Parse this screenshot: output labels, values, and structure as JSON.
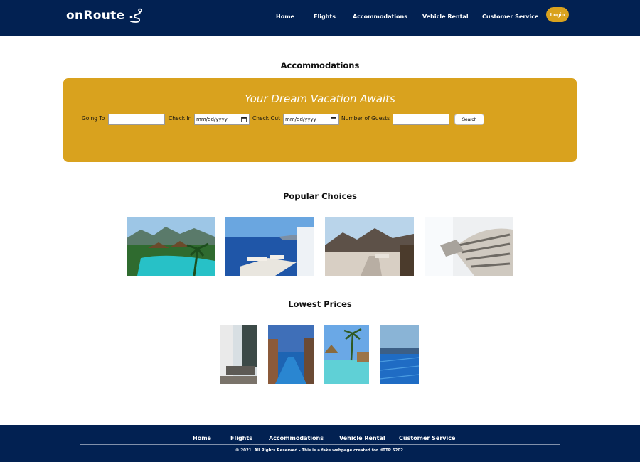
{
  "header": {
    "brand": "onRoute",
    "nav": [
      "Home",
      "Flights",
      "Accommodations",
      "Vehicle Rental",
      "Customer Service"
    ],
    "login_label": "Login"
  },
  "main": {
    "page_title": "Accommodations",
    "search": {
      "heading": "Your Dream Vacation Awaits",
      "going_to_label": "Going To",
      "check_in_label": "Check In",
      "check_in_value": "mm/dd/yyyy",
      "check_out_label": "Check Out",
      "check_out_value": "mm/dd/yyyy",
      "guests_label": "Number of Guests",
      "search_label": "Search"
    },
    "popular_title": "Popular Choices",
    "popular_photos": [
      "tropical-pool-resort",
      "ocean-view-terrace",
      "mountain-view-rooftop",
      "bed-with-pillows"
    ],
    "lowest_title": "Lowest Prices",
    "lowest_photos": [
      "modern-lounge-interior",
      "resort-pool-dusk",
      "palm-pool-resort",
      "infinity-pool-sea"
    ]
  },
  "footer": {
    "nav": [
      "Home",
      "Flights",
      "Accommodations",
      "Vehicle Rental",
      "Customer Service"
    ],
    "copyright": "© 2021. All Rights Reserved - This is a fake webpage created for HTTP 5202."
  },
  "colors": {
    "navy": "#022152",
    "gold": "#d9a21e",
    "white": "#ffffff"
  }
}
